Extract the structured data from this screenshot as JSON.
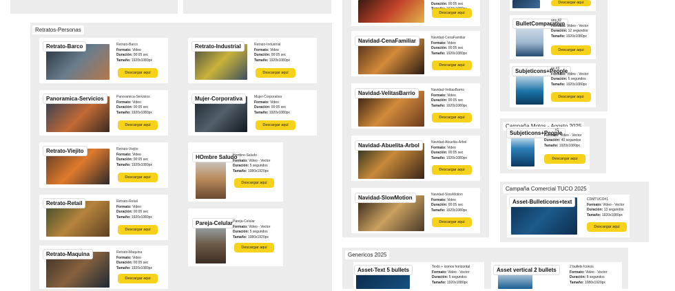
{
  "colors": {
    "group_bg": "#ececec",
    "card_bg": "#ffffff",
    "button": "#f7d21a"
  },
  "meta_labels": {
    "format": "Formato:",
    "duration": "Duración:",
    "size": "Tamaño:"
  },
  "retratos": {
    "title": "Retratos-Personas",
    "cards": [
      {
        "title": "Retrato-Barco",
        "name": "Retrato-Barco",
        "format": "Video",
        "duration": "00:05 sec",
        "size": "1920x1080px",
        "button": "Descargar aqui"
      },
      {
        "title": "Retrato-Industrial",
        "name": "Retrato-Industrial",
        "format": "Video",
        "duration": "00:05 sec",
        "size": "1920x1080px",
        "button": "Descargar aqui"
      },
      {
        "title": "Panoramica-Servicios",
        "name": "Panoramica-Servicios",
        "format": "Video",
        "duration": "00:05 sec",
        "size": "1920x1080px",
        "button": "Descargar aqui"
      },
      {
        "title": "Mujer-Corporativa",
        "name": "Mujer-Corporativa",
        "format": "Video",
        "duration": "00:05 sec",
        "size": "1920x1080px",
        "button": "Descargar aqui"
      },
      {
        "title": "Retrato-Viejito",
        "name": "Retrato-Viejito",
        "format": "Video",
        "duration": "00:05 sec",
        "size": "1920x1080px",
        "button": "Descargar aqui"
      },
      {
        "title": "HOmbre Saludo",
        "name": "Hombre-Saludo",
        "format": "Video - Vector",
        "duration": "5 segundos",
        "size": "1080x1920px",
        "button": "Descargar aqui"
      },
      {
        "title": "Retrato-Retail",
        "name": "Retrato-Retail",
        "format": "Video",
        "duration": "00:05 sec",
        "size": "1920x1080px",
        "button": "Descargar aqui"
      },
      {
        "title": "Pareja-Celular",
        "name": "Pareja-Celular",
        "format": "Video - Vector",
        "duration": "5 segundos",
        "size": "1080x1920px",
        "button": "Descargar aqui"
      },
      {
        "title": "Retrato-Maquina",
        "name": "Retrato-Maquina",
        "format": "Video",
        "duration": "00:05 sec",
        "size": "1920x1080px",
        "button": "Descargar aqui"
      }
    ]
  },
  "navidad": {
    "cards": [
      {
        "title": "",
        "name": "",
        "format": "Video",
        "duration": "00:05 sec",
        "size": "1920x1080px",
        "button": "Descargar aqui"
      },
      {
        "title": "Navidad-CenaFamiliar",
        "name": "Navidad-CenaFamiliar",
        "format": "Video",
        "duration": "00:05 sec",
        "size": "1920x1080px",
        "button": "Descargar aqui"
      },
      {
        "title": "Navidad-VelitasBarrio",
        "name": "Navidad-VelitasBarrio",
        "format": "Video",
        "duration": "00:05 sec",
        "size": "1920x1080px",
        "button": "Descargar aqui"
      },
      {
        "title": "Navidad-Abuelita-Arbol",
        "name": "Navidad-Abuelita-Arbol",
        "format": "Video",
        "duration": "00:05 sec",
        "size": "1920x1080px",
        "button": "Descargar aqui"
      },
      {
        "title": "Navidad-SlowMotion",
        "name": "Navidad-SlowMotion",
        "format": "Video",
        "duration": "00:05 sec",
        "size": "1920x1080px",
        "button": "Descargar aqui"
      }
    ]
  },
  "right_top": {
    "top_card": {
      "button": "Descargar aqui"
    },
    "bullet": {
      "title": "BulletComparativo",
      "name": "ons #2",
      "format": "Video - Vector",
      "duration": "12 segundos",
      "size": "1920x1080px",
      "button": "Descargar aqui"
    },
    "subjeticons": {
      "title": "Subjeticons+People",
      "name": "ns #3",
      "format": "Video - Vector",
      "duration": "5 segundos",
      "size": "1920x1080px",
      "button": "Descargar aqui"
    }
  },
  "motos": {
    "title": "Campaña Motos - Agosto 2025",
    "card": {
      "title": "Subjeticons+People",
      "name": "s1",
      "format": "Video - Vector",
      "duration": "40 segundos",
      "size": "1920x1080px",
      "button": "Descargar aqui"
    }
  },
  "tuco": {
    "title": "Campaña Comercial TUCO 2025",
    "card": {
      "title": "Asset-Bulleticons+text",
      "name": "CDMTUCO#1",
      "format": "Video - Vector",
      "duration": "13 segundos",
      "size": "1920x1080px",
      "button": "Descargar aqui"
    }
  },
  "genericos": {
    "title": "Genericos 2025",
    "cards": [
      {
        "title": "Asset-Text 5 bullets",
        "name": "Texto + iconos horizontal",
        "format": "Video - Vector",
        "duration": "5 segundos",
        "size": "1920x1080px"
      },
      {
        "title": "Asset vertical 2 bullets",
        "name": "2 bullets Iconos",
        "format": "Video - Vector",
        "duration": "8 segundos",
        "size": "1080x1920px"
      }
    ]
  }
}
